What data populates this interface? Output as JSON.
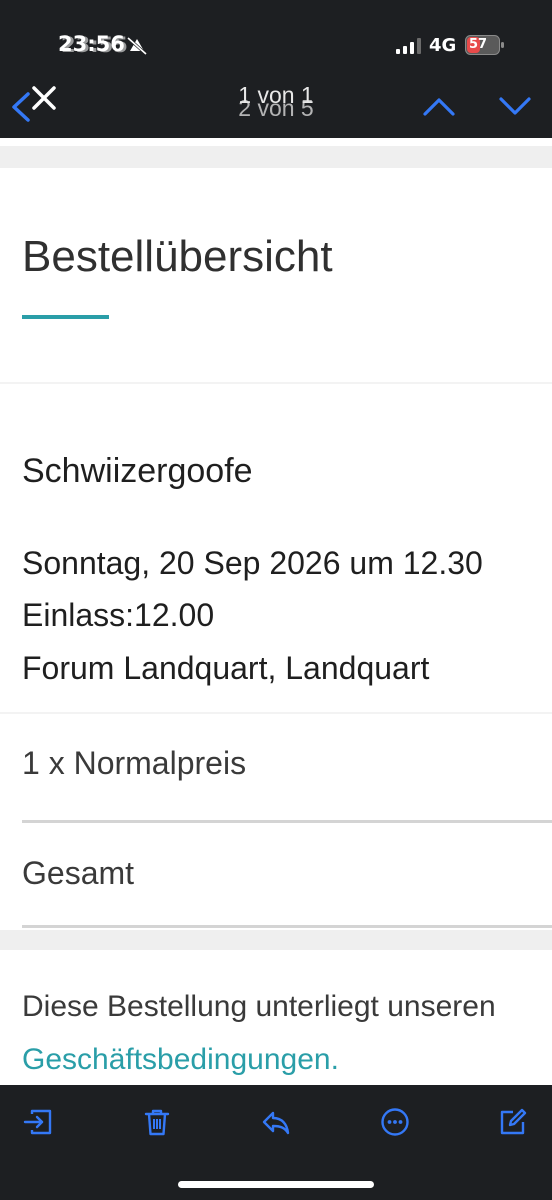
{
  "status_bar": {
    "time": "23:56",
    "time_ghost": "23:55",
    "network": "4G",
    "battery": "57"
  },
  "nav": {
    "pager": "1 von 1",
    "pager_ghost": "2 von 5",
    "back_icon": "chevron-left-icon",
    "close_icon": "close-icon",
    "up_icon": "chevron-up-icon",
    "down_icon": "chevron-down-icon"
  },
  "email": {
    "heading": "Bestellübersicht",
    "event": {
      "name": "Schwiizergoofe",
      "date": "Sonntag, 20 Sep 2026 um 12.30",
      "admission": "Einlass:12.00",
      "venue": "Forum Landquart, Landquart"
    },
    "items": [
      {
        "label": "1 x Normalpreis"
      },
      {
        "label": "Gesamt"
      }
    ],
    "terms_text": "Diese Bestellung unterliegt unseren",
    "terms_link": "Geschäftsbedingungen."
  },
  "toolbar": {
    "icons": [
      "move-to-inbox-icon",
      "trash-icon",
      "reply-icon",
      "more-icon",
      "compose-icon"
    ]
  },
  "colors": {
    "accent": "#2a9ea8",
    "toolbar_icon": "#3478f6",
    "bar_background": "#1d1f22"
  }
}
